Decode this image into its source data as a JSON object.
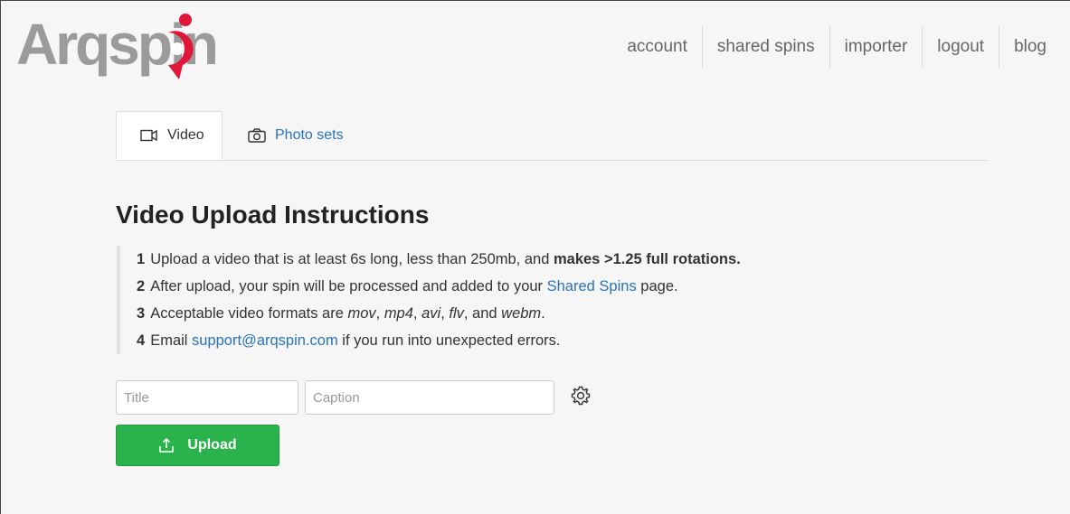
{
  "brand": {
    "logo_text": "Arqspin",
    "logo_accent": "#e0163b",
    "logo_gray": "#9b9b9b"
  },
  "nav": [
    {
      "label": "account"
    },
    {
      "label": "shared spins"
    },
    {
      "label": "importer"
    },
    {
      "label": "logout"
    },
    {
      "label": "blog"
    }
  ],
  "tabs": {
    "video": {
      "label": "Video",
      "icon": "video-camera-icon",
      "active": true
    },
    "photos": {
      "label": "Photo sets",
      "icon": "camera-icon",
      "active": false
    }
  },
  "main": {
    "heading": "Video Upload Instructions",
    "instructions": [
      {
        "num": "1",
        "pre": "Upload a video that is at least 6s long, less than 250mb, and ",
        "bold": "makes >1.25 full rotations."
      },
      {
        "num": "2",
        "pre": "After upload, your spin will be processed and added to your ",
        "link": "Shared Spins",
        "post": " page."
      },
      {
        "num": "3",
        "pre": "Acceptable video formats are ",
        "f1": "mov",
        "s1": ", ",
        "f2": "mp4",
        "s2": ", ",
        "f3": "avi",
        "s3": ", ",
        "f4": "flv",
        "s4": ", and ",
        "f5": "webm",
        "post": "."
      },
      {
        "num": "4",
        "pre": "Email ",
        "link": "support@arqspin.com",
        "post": " if you run into unexpected errors."
      }
    ]
  },
  "form": {
    "title_placeholder": "Title",
    "caption_placeholder": "Caption",
    "settings_icon": "gear-icon",
    "upload_label": "Upload",
    "upload_icon": "upload-icon",
    "upload_color": "#2ab24c",
    "link_color": "#2a74b7"
  }
}
